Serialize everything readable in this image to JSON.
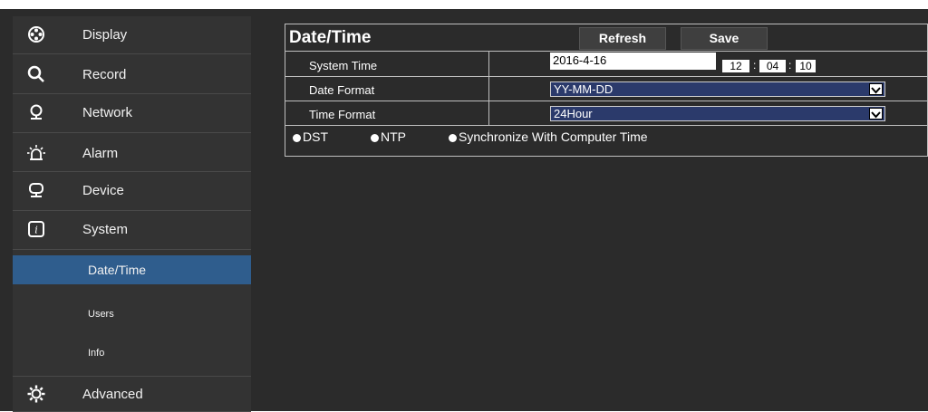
{
  "sidebar": {
    "items": [
      {
        "label": "Display",
        "icon": "film-reel-icon"
      },
      {
        "label": "Record",
        "icon": "search-icon"
      },
      {
        "label": "Network",
        "icon": "pin-icon"
      },
      {
        "label": "Alarm",
        "icon": "alarm-bell-icon"
      },
      {
        "label": "Device",
        "icon": "monitor-icon"
      },
      {
        "label": "System",
        "icon": "system-icon"
      },
      {
        "label": "Advanced",
        "icon": "gear-icon"
      }
    ],
    "subitems": [
      {
        "label": "Date/Time",
        "active": true
      },
      {
        "label": "Users",
        "active": false
      },
      {
        "label": "Info",
        "active": false
      }
    ]
  },
  "main": {
    "title": "Date/Time",
    "refresh_label": "Refresh",
    "save_label": "Save",
    "rows": {
      "system_time_label": "System Time",
      "date_format_label": "Date Format",
      "time_format_label": "Time Format"
    },
    "system_date": "2016-4-16",
    "time": {
      "hour": "12",
      "minute": "04",
      "second": "10"
    },
    "date_format_value": "YY-MM-DD",
    "time_format_value": "24Hour",
    "options": {
      "dst": "DST",
      "ntp": "NTP",
      "sync": "Synchronize With Computer Time"
    }
  },
  "colors": {
    "sidebar_bg": "#333333",
    "main_bg": "#2b2b2b",
    "active_item": "#2f5d8d",
    "select_bg": "#2b3a6b"
  }
}
